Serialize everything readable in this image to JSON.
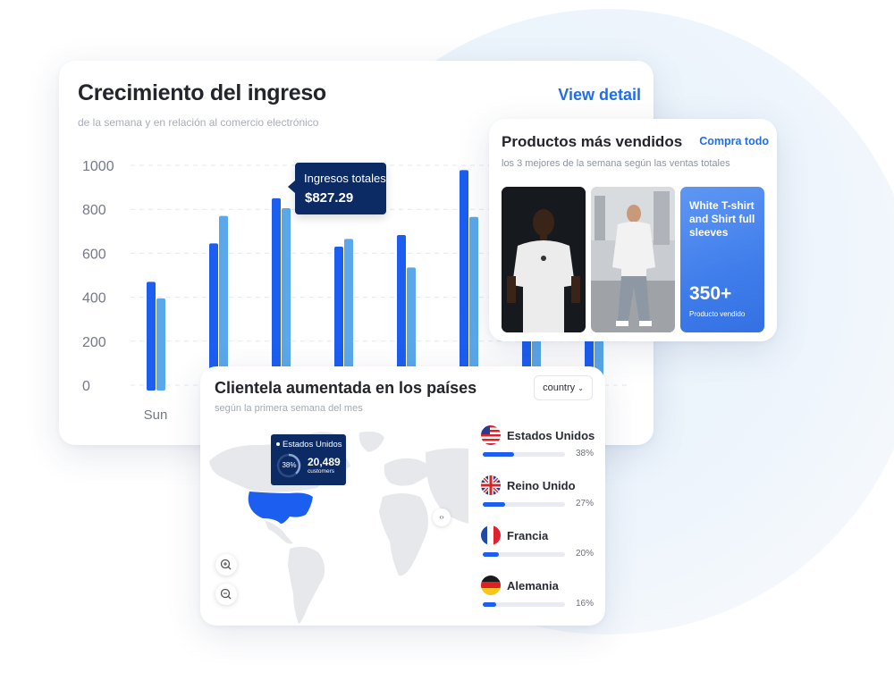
{
  "revenue_card": {
    "title": "Crecimiento del ingreso",
    "subtitle": "de la semana y en relación al comercio electrónico",
    "view_detail": "View detail",
    "tooltip": {
      "label": "Ingresos totales",
      "value": "$827.29"
    }
  },
  "chart_data": {
    "type": "bar",
    "categories": [
      "Sun",
      "",
      "",
      "",
      "",
      "",
      "",
      ""
    ],
    "series": [
      {
        "values": [
          470,
          645,
          850,
          630,
          683,
          978,
          820,
          560
        ]
      },
      {
        "values": [
          395,
          770,
          805,
          665,
          535,
          765,
          610,
          480
        ]
      }
    ],
    "ylim": [
      0,
      1000
    ],
    "yticks": [
      1000,
      800,
      600,
      400,
      200,
      0
    ],
    "grid": true,
    "colors": [
      "#1b5ef0",
      "#5aa8ea"
    ]
  },
  "products_card": {
    "title": "Productos más vendidos",
    "link": "Compra todo",
    "subtitle": "los 3 mejores de la semana según las ventas totales",
    "feature": {
      "name": "White T-shirt and Shirt full sleeves",
      "count": "350+",
      "label": "Producto vendido"
    }
  },
  "clients_card": {
    "title": "Clientela aumentada en los países",
    "subtitle": "según la primera semana del mes",
    "dropdown": "country",
    "dropdown_icon": "chevron-down-icon",
    "map_tooltip": {
      "country": "Estados Unidos",
      "percent": "38%",
      "percent_value": 0.38,
      "count": "20,489",
      "unit": "customers"
    },
    "countries": [
      {
        "name": "Estados Unidos",
        "percent": "38%",
        "fraction": 0.38,
        "flag": "us-flag-icon"
      },
      {
        "name": "Reino Unido",
        "percent": "27%",
        "fraction": 0.27,
        "flag": "uk-flag-icon"
      },
      {
        "name": "Francia",
        "percent": "20%",
        "fraction": 0.2,
        "flag": "france-flag-icon"
      },
      {
        "name": "Alemania",
        "percent": "16%",
        "fraction": 0.16,
        "flag": "germany-flag-icon"
      }
    ],
    "zoom_in_icon": "zoom-in-icon",
    "zoom_out_icon": "zoom-out-icon",
    "highlight_color": "#1b5ef0"
  }
}
